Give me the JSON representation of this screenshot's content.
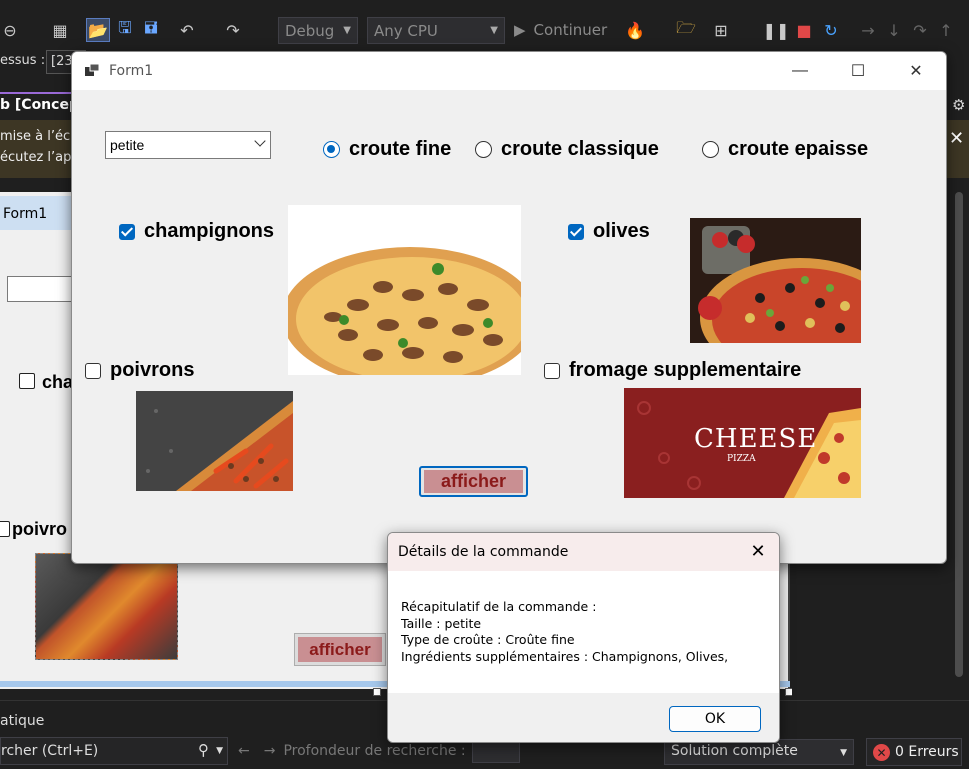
{
  "ide": {
    "toolbar": {
      "config_combo": "Debug",
      "platform_combo": "Any CPU",
      "continue_label": "Continuer"
    },
    "process_label": "essus :",
    "process_value": "[23",
    "design_tab_label": "b [Concept",
    "info_line1": " mise à l’éc",
    "info_line2": "écutez l’ap",
    "design": {
      "form_title": "Form1",
      "checkbox_cha": "cha",
      "checkbox_poivro": "poivro",
      "afficher_label": "afficher"
    },
    "bottom": {
      "panel_label": "atique",
      "search_placeholder": "rcher (Ctrl+E)",
      "depth_label": "Profondeur de recherche :",
      "solution_combo": "Solution complète",
      "errors_label": "0 Erreurs"
    }
  },
  "form1": {
    "title": "Form1",
    "size_combo_value": "petite",
    "crust_options": [
      {
        "label": "croute fine",
        "selected": true
      },
      {
        "label": "croute classique",
        "selected": false
      },
      {
        "label": "croute epaisse",
        "selected": false
      }
    ],
    "toppings": {
      "champignons": {
        "label": "champignons",
        "checked": true
      },
      "olives": {
        "label": "olives",
        "checked": true
      },
      "poivrons": {
        "label": "poivrons",
        "checked": false
      },
      "fromage": {
        "label": "fromage supplementaire",
        "checked": false
      }
    },
    "cheese_image_text": "CHEESE",
    "cheese_image_subtext": "PIZZA",
    "afficher_label": "afficher"
  },
  "message_box": {
    "title": "Détails de la commande",
    "lines": [
      "Récapitulatif de la commande :",
      "Taille : petite",
      "Type de croûte : Croûte fine",
      "Ingrédients supplémentaires : Champignons, Olives,"
    ],
    "ok_label": "OK"
  },
  "colors": {
    "accent": "#0067c0",
    "button_fill": "#c98f92",
    "button_text": "#8b1a1a",
    "ide_bg": "#1f1f1f",
    "error_red": "#e04848"
  }
}
